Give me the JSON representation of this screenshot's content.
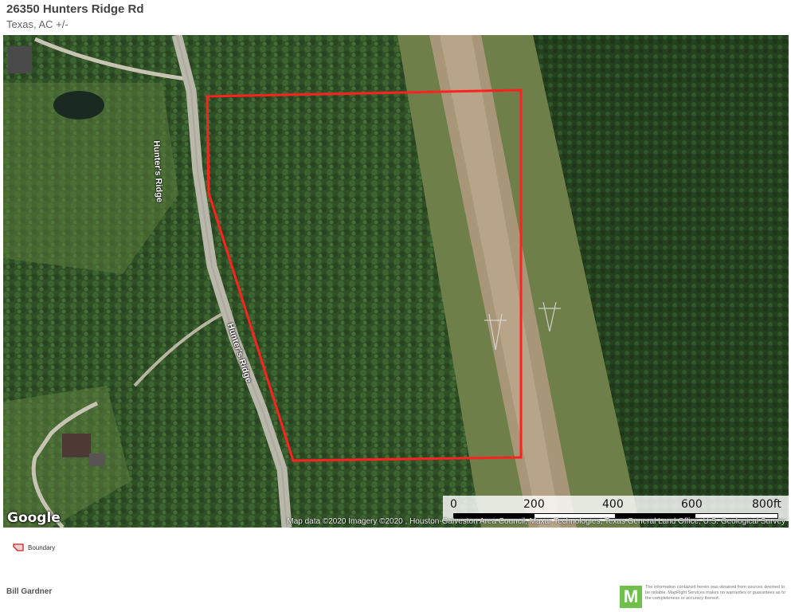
{
  "header": {
    "title": "26350 Hunters Ridge Rd",
    "subtitle": "Texas,  AC +/-"
  },
  "map": {
    "roads": [
      {
        "label": "Hunter's Ridge"
      },
      {
        "label": "Hunter's Ridge"
      }
    ],
    "google_logo": "Google",
    "attribution": "Map data ©2020  Imagery ©2020 , Houston-Galveston Area Council, Maxar Technologies, Texas General Land Office, U.S. Geological Survey",
    "scale": {
      "labels": [
        "0",
        "200",
        "400",
        "600",
        "800ft"
      ]
    },
    "boundary_color": "#ff2020"
  },
  "legend": {
    "items": [
      {
        "label": "Boundary",
        "icon": "boundary-icon",
        "color": "#cc2222"
      }
    ]
  },
  "footer": {
    "agent": "Bill Gardner",
    "logo_letter": "M",
    "disclaimer": "The information contained herein was obtained from sources deemed to be reliable. MapRight Services makes no warranties or guarantees as to the completeness or accuracy thereof."
  }
}
